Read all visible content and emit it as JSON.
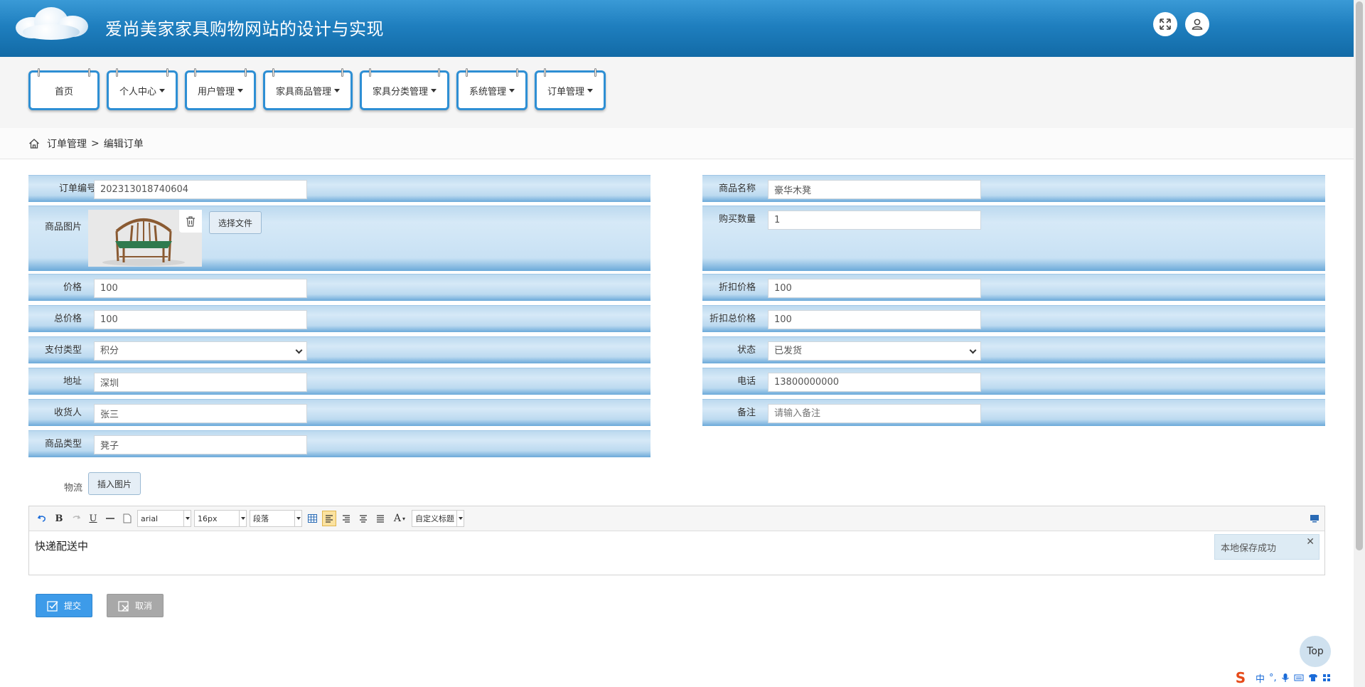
{
  "header": {
    "site_title": "爱尚美家家具购物网站的设计与实现",
    "fullscreen_icon": "expand-icon",
    "user_icon": "user-icon"
  },
  "nav": {
    "items": [
      {
        "label": "首页",
        "dropdown": false
      },
      {
        "label": "个人中心",
        "dropdown": true
      },
      {
        "label": "用户管理",
        "dropdown": true
      },
      {
        "label": "家具商品管理",
        "dropdown": true
      },
      {
        "label": "家具分类管理",
        "dropdown": true
      },
      {
        "label": "系统管理",
        "dropdown": true
      },
      {
        "label": "订单管理",
        "dropdown": true
      }
    ]
  },
  "breadcrumb": {
    "home_icon": "home-icon",
    "parent": "订单管理",
    "separator": ">",
    "current": "编辑订单"
  },
  "form": {
    "order_no": {
      "label": "订单编号",
      "value": "202313018740604"
    },
    "product_name": {
      "label": "商品名称",
      "value": "豪华木凳"
    },
    "product_image": {
      "label": "商品图片",
      "choose_label": "选择文件",
      "delete_icon": "trash-icon"
    },
    "quantity": {
      "label": "购买数量",
      "value": "1"
    },
    "price": {
      "label": "价格",
      "value": "100"
    },
    "discount_price": {
      "label": "折扣价格",
      "value": "100"
    },
    "total_price": {
      "label": "总价格",
      "value": "100"
    },
    "discount_total": {
      "label": "折扣总价格",
      "value": "100"
    },
    "pay_type": {
      "label": "支付类型",
      "value": "积分"
    },
    "status": {
      "label": "状态",
      "value": "已发货"
    },
    "address": {
      "label": "地址",
      "value": "深圳"
    },
    "phone": {
      "label": "电话",
      "value": "13800000000"
    },
    "receiver": {
      "label": "收货人",
      "value": "张三"
    },
    "remark": {
      "label": "备注",
      "value": "",
      "placeholder": "请输入备注"
    },
    "product_type": {
      "label": "商品类型",
      "value": "凳子"
    },
    "logistics": {
      "label": "物流",
      "insert_image": "插入图片"
    }
  },
  "editor": {
    "font": "arial",
    "size": "16px",
    "paragraph": "段落",
    "custom_title": "自定义标题",
    "content": "快递配送中",
    "toast": "本地保存成功",
    "toast_close": "✕"
  },
  "actions": {
    "submit": "提交",
    "cancel": "取消",
    "top": "Top"
  },
  "ime": {
    "lang": "中",
    "punct": "°,"
  },
  "colors": {
    "header": "#1f7fbf",
    "nav_border": "#2e8fd4",
    "row_band": "#bcd9ef",
    "submit": "#3d9be9",
    "cancel": "#a8a8a8"
  }
}
